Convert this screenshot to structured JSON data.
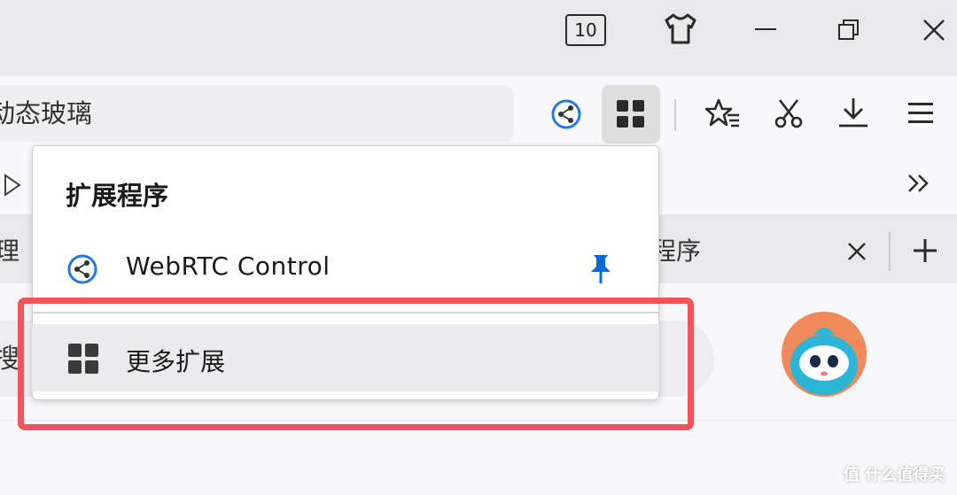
{
  "titlebar": {
    "tab_count": "10"
  },
  "toolbar": {
    "url_text": "动态玻璃"
  },
  "tabs": {
    "left_partial": "理（",
    "right_partial": "程序"
  },
  "page": {
    "search_partial": "搜"
  },
  "extensions_panel": {
    "title": "扩展程序",
    "items": [
      {
        "name": "WebRTC Control"
      }
    ],
    "more_label": "更多扩展"
  },
  "watermark": "值 什么值得买",
  "colors": {
    "highlight": "#f2545b",
    "pin_blue": "#0a6ad8",
    "ext_icon_blue": "#1f7be3"
  }
}
